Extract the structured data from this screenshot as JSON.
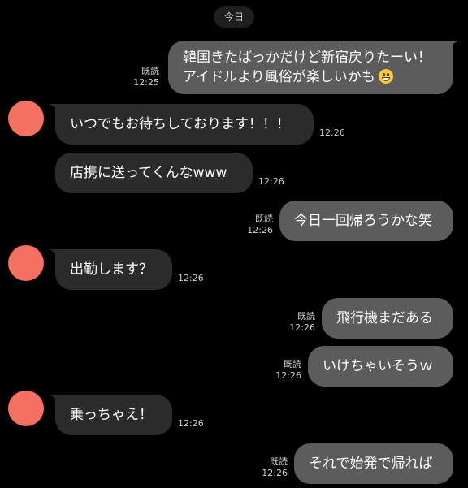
{
  "date_label": "今日",
  "messages": [
    {
      "id": "m1",
      "side": "out",
      "lines": [
        "韓国きたばっかだけど新宿戻りたーい！",
        "アイドルより風俗が楽しいかも"
      ],
      "emoji": "grinning-face-emoji",
      "read": "既読",
      "time": "12:25"
    },
    {
      "id": "m2",
      "side": "in",
      "text": "いつでもお待ちしております！！！",
      "time": "12:26"
    },
    {
      "id": "m3",
      "side": "in",
      "text": "店携に送ってくんなwww",
      "time": "12:26"
    },
    {
      "id": "m4",
      "side": "out",
      "text": "今日一回帰ろうかな笑",
      "read": "既読",
      "time": "12:26"
    },
    {
      "id": "m5",
      "side": "in",
      "text": "出勤します？",
      "time": "12:26"
    },
    {
      "id": "m6",
      "side": "out",
      "text": "飛行機まだある",
      "read": "既読",
      "time": "12:26"
    },
    {
      "id": "m7",
      "side": "out",
      "text": "いけちゃいそうｗ",
      "read": "既読",
      "time": "12:26"
    },
    {
      "id": "m8",
      "side": "in",
      "text": "乗っちゃえ！",
      "time": "12:26"
    },
    {
      "id": "m9",
      "side": "out",
      "text": "それで始発で帰れば",
      "read": "既読",
      "time": "12:26"
    }
  ],
  "colors": {
    "background": "#000000",
    "outgoing_bubble": "#5c5c5c",
    "incoming_bubble": "#2b2b2b",
    "avatar": "#f56f63"
  }
}
